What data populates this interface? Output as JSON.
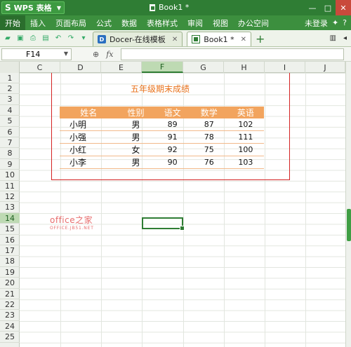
{
  "titlebar": {
    "app_logo": "S",
    "app_name": "WPS 表格",
    "doc_title": "Book1 *",
    "controls": [
      "—",
      "□",
      "✕"
    ]
  },
  "menubar": {
    "items": [
      "开始",
      "插入",
      "页面布局",
      "公式",
      "数据",
      "表格样式",
      "审阅",
      "视图",
      "办公空间"
    ],
    "active_index": 0,
    "login": "未登录"
  },
  "tabbar": {
    "tabs": [
      {
        "label": "Docer-在线模板",
        "active": false
      },
      {
        "label": "Book1 *",
        "active": true
      }
    ],
    "add": "+"
  },
  "formulabar": {
    "name_box": "F14",
    "fx_label": "fx",
    "formula_value": ""
  },
  "grid": {
    "columns": [
      "C",
      "D",
      "E",
      "F",
      "G",
      "H",
      "I",
      "J"
    ],
    "selected_column": "F",
    "rows": [
      "1",
      "2",
      "3",
      "4",
      "5",
      "6",
      "7",
      "8",
      "9",
      "10",
      "11",
      "12",
      "13",
      "14",
      "15",
      "16",
      "17",
      "18",
      "19",
      "20",
      "21",
      "22",
      "23",
      "24",
      "25"
    ],
    "selected_row": "14"
  },
  "sheet": {
    "title": "五年级期末成绩",
    "headers": [
      "姓名",
      "性别",
      "语文",
      "数学",
      "英语"
    ],
    "rows": [
      [
        "小明",
        "男",
        "89",
        "87",
        "102"
      ],
      [
        "小强",
        "男",
        "91",
        "78",
        "111"
      ],
      [
        "小红",
        "女",
        "92",
        "75",
        "100"
      ],
      [
        "小李",
        "男",
        "90",
        "76",
        "103"
      ]
    ]
  },
  "watermark": {
    "main": "office之家",
    "sub": "OFFICE.JB51.NET"
  },
  "colors": {
    "title_green": "#2f7d34",
    "header_orange": "#f2a45e",
    "title_orange": "#e8721c",
    "border_red": "#d42323"
  }
}
